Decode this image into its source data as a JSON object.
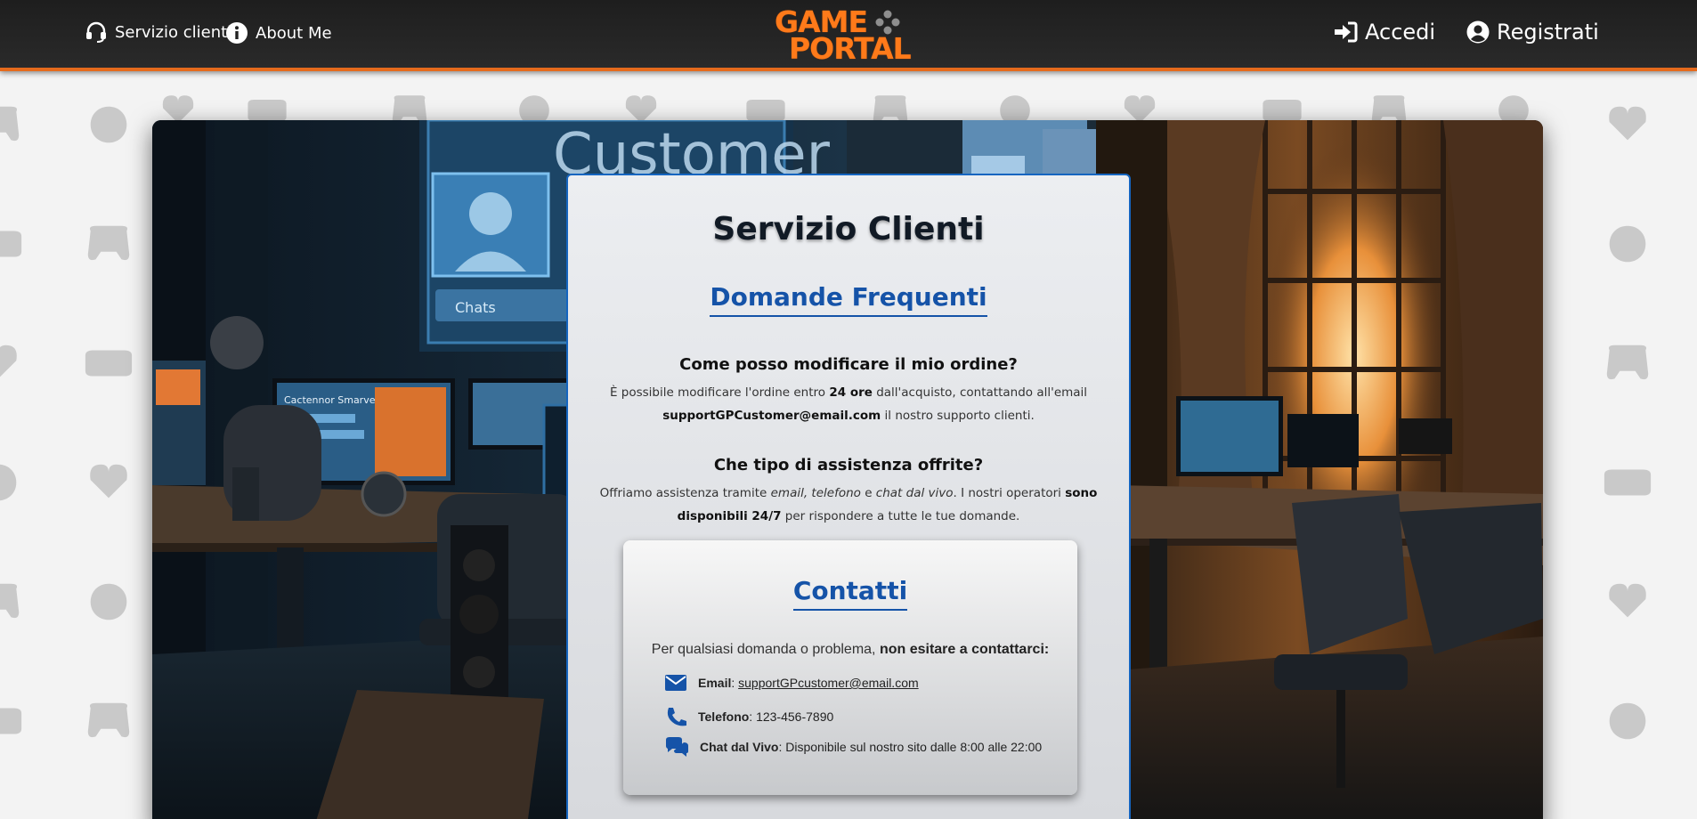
{
  "colors": {
    "accent_orange": "#e56a1c",
    "navbar_bg": "#232323",
    "primary_blue": "#1553a8",
    "card_border": "#1565c0"
  },
  "navbar": {
    "left_links": [
      {
        "label": "Servizio clienti",
        "icon": "headset-icon"
      },
      {
        "label": "About Me",
        "icon": "info-circle-icon"
      }
    ],
    "logo": {
      "line1": "GAME",
      "line2": "PORTAL"
    },
    "right_links": [
      {
        "label": "Accedi",
        "icon": "sign-in-icon"
      },
      {
        "label": "Registrati",
        "icon": "user-circle-icon"
      }
    ]
  },
  "hero": {
    "sign_text": "Customer S",
    "chat_label": "Chats",
    "monitor_text": "Cactennor Smarve"
  },
  "card": {
    "title": "Servizio Clienti",
    "faq_heading": "Domande Frequenti",
    "faqs": [
      {
        "question": "Come posso modificare il mio ordine?",
        "answer_parts": [
          "È possibile modificare l'ordine entro ",
          "24 ore",
          " dall'acquisto, contattando all'email ",
          "supportGPCustomer@email.com",
          " il nostro supporto clienti."
        ]
      },
      {
        "question": "Che tipo di assistenza offrite?",
        "answer_parts": [
          "Offriamo assistenza tramite ",
          "email, telefono",
          " e ",
          "chat dal vivo",
          ". I nostri operatori ",
          "sono disponibili 24/7",
          " per rispondere a tutte le tue domande."
        ]
      }
    ],
    "contacts": {
      "heading": "Contatti",
      "intro": "Per qualsiasi domanda o problema, ",
      "intro_bold": "non esitare a contattarci:",
      "items": [
        {
          "icon": "envelope-icon",
          "label": "Email",
          "value": "supportGPcustomer@email.com"
        },
        {
          "icon": "phone-icon",
          "label": "Telefono",
          "value": "123-456-7890"
        },
        {
          "icon": "chat-bubbles-icon",
          "label": "Chat dal Vivo",
          "value": "Disponibile sul nostro sito dalle 8:00 alle 22:00"
        }
      ]
    }
  }
}
